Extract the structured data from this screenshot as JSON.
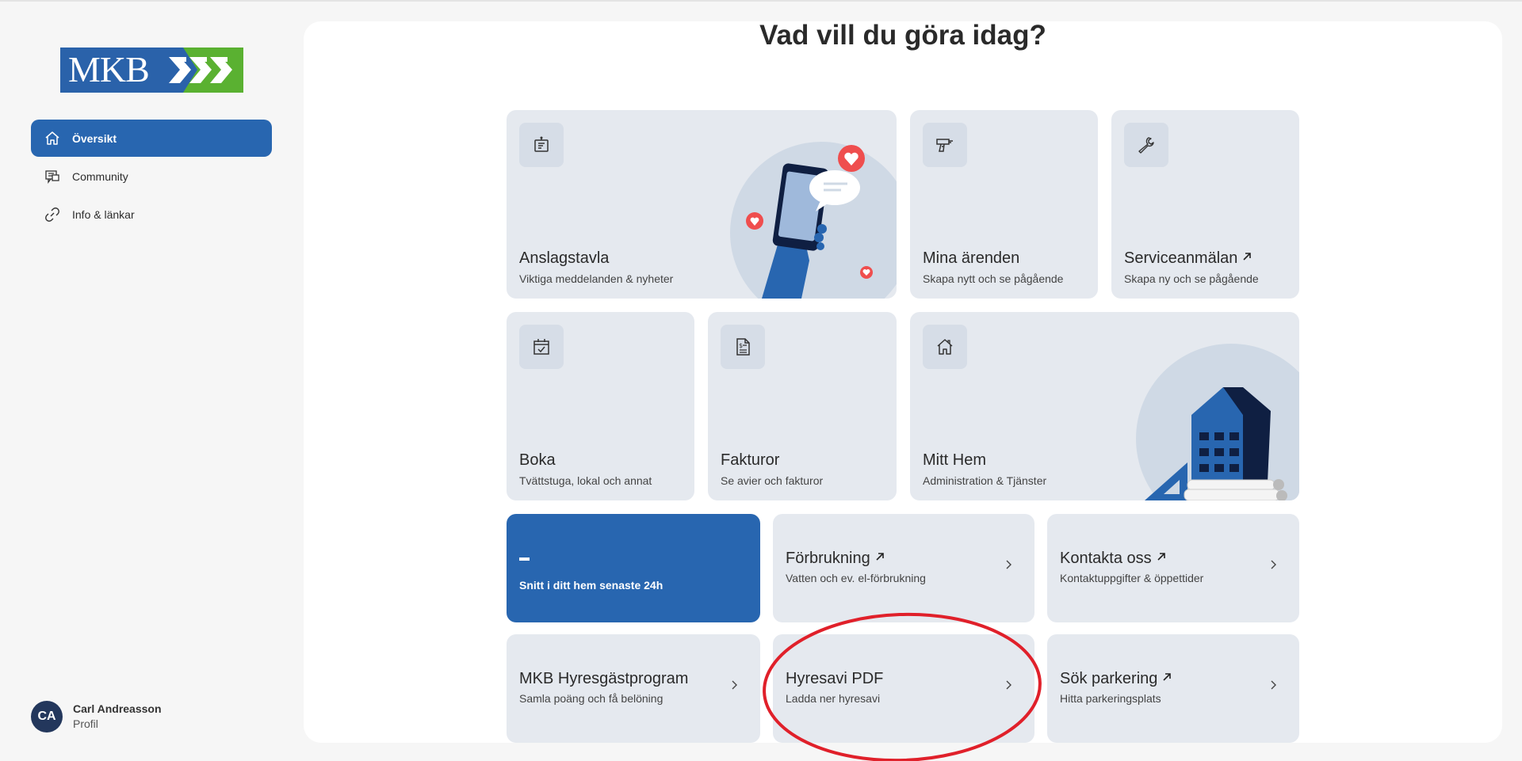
{
  "sidebar": {
    "logo_text": "MKB",
    "nav": [
      {
        "label": "Översikt",
        "icon": "home-icon",
        "active": true
      },
      {
        "label": "Community",
        "icon": "chat-icon",
        "active": false
      },
      {
        "label": "Info & länkar",
        "icon": "link-icon",
        "active": false
      }
    ],
    "profile": {
      "initials": "CA",
      "name": "Carl Andreasson",
      "sub": "Profil"
    }
  },
  "main": {
    "title": "Vad vill du göra idag?",
    "tiles": {
      "anslagstavla": {
        "title": "Anslagstavla",
        "sub": "Viktiga meddelanden & nyheter",
        "icon": "notice-board-icon"
      },
      "mina_arenden": {
        "title": "Mina ärenden",
        "sub": "Skapa nytt och se pågående",
        "icon": "drill-icon"
      },
      "serviceanmalan": {
        "title": "Serviceanmälan",
        "sub": "Skapa ny och se pågående",
        "icon": "wrench-icon",
        "external": true
      },
      "boka": {
        "title": "Boka",
        "sub": "Tvättstuga, lokal och annat",
        "icon": "calendar-icon"
      },
      "fakturor": {
        "title": "Fakturor",
        "sub": "Se avier och fakturor",
        "icon": "invoice-icon"
      },
      "mitt_hem": {
        "title": "Mitt Hem",
        "sub": "Administration & Tjänster",
        "icon": "house-icon"
      },
      "snitt": {
        "value": "-",
        "sub": "Snitt i ditt hem senaste 24h"
      },
      "forbrukning": {
        "title": "Förbrukning",
        "sub": "Vatten och ev. el-förbrukning",
        "external": true
      },
      "kontakta": {
        "title": "Kontakta oss",
        "sub": "Kontaktuppgifter & öppettider",
        "external": true
      },
      "hyresgastprogram": {
        "title": "MKB Hyresgästprogram",
        "sub": "Samla poäng och få belöning"
      },
      "hyresavi": {
        "title": "Hyresavi PDF",
        "sub": "Ladda ner hyresavi"
      },
      "parkering": {
        "title": "Sök parkering",
        "sub": "Hitta parkeringsplats",
        "external": true
      }
    }
  },
  "colors": {
    "accent": "#2866b0",
    "tile_bg": "#e5e9ef",
    "annotation": "#e0202a",
    "avatar": "#23375c",
    "logo_green": "#5ab131"
  }
}
